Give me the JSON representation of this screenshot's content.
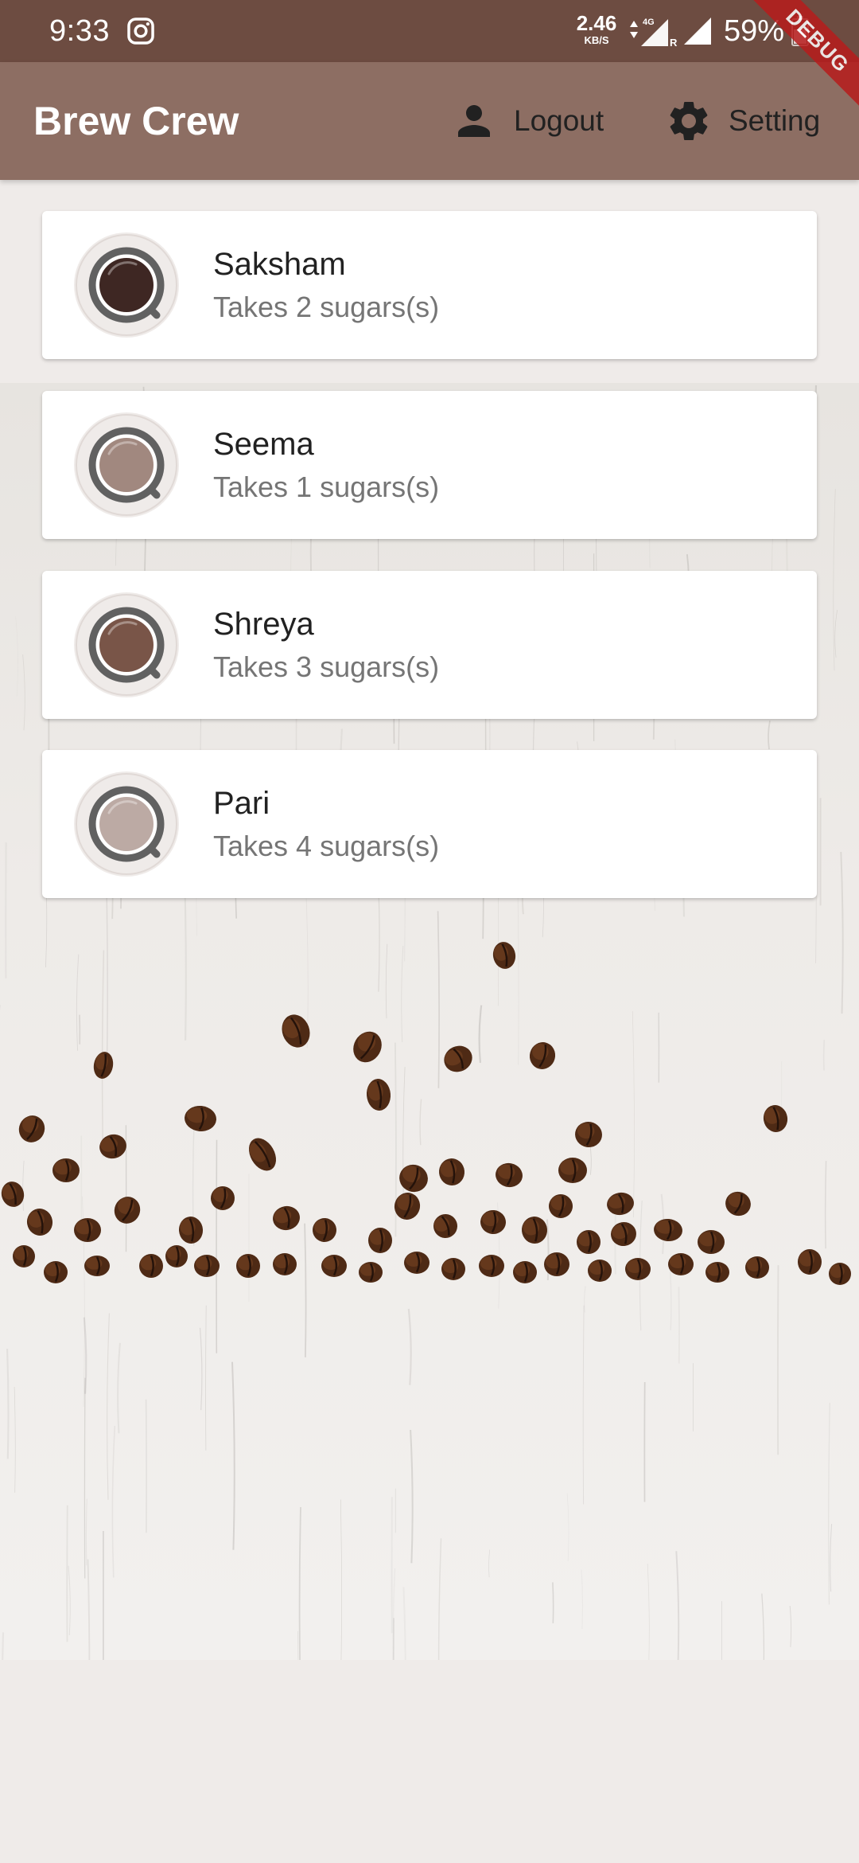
{
  "status_bar": {
    "time": "9:33",
    "speed_value": "2.46",
    "speed_unit": "KB/S",
    "network_type": "4G",
    "roaming_indicator": "R",
    "battery": "59%",
    "icons": [
      "instagram-icon",
      "data-arrows-icon",
      "signal-icon",
      "signal-icon",
      "battery-icon"
    ]
  },
  "debug_banner": "DEBUG",
  "app_bar": {
    "title": "Brew Crew",
    "actions": [
      {
        "label": "Logout",
        "icon": "person-icon"
      },
      {
        "label": "Setting",
        "icon": "gear-icon"
      }
    ]
  },
  "brews": [
    {
      "name": "Saksham",
      "subtitle": "Takes 2 sugars(s)",
      "coffee_color": "#3e2723"
    },
    {
      "name": "Seema",
      "subtitle": "Takes 1 sugars(s)",
      "coffee_color": "#a1887f"
    },
    {
      "name": "Shreya",
      "subtitle": "Takes 3 sugars(s)",
      "coffee_color": "#795548"
    },
    {
      "name": "Pari",
      "subtitle": "Takes 4 sugars(s)",
      "coffee_color": "#bcaaa4"
    }
  ],
  "colors": {
    "status_bar": "#6d4c41",
    "app_bar": "#8d6e63",
    "page_background": "#efebe9",
    "avatar_background": "#efebe9",
    "cup_ring": "#616161",
    "debug_ribbon": "#b71c1c"
  }
}
